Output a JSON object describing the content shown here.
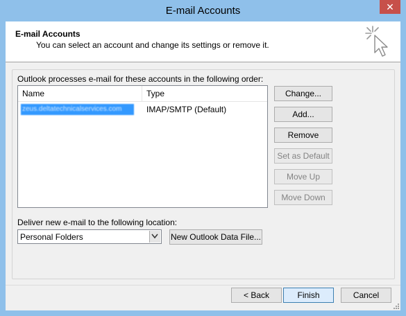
{
  "window": {
    "title": "E-mail Accounts",
    "close_label": "✕",
    "accent_color": "#8fc0ea",
    "close_color": "#c7504a"
  },
  "header": {
    "title": "E-mail Accounts",
    "subtitle": "You can select an account and change its settings or remove it.",
    "icon": "cursor-click-icon"
  },
  "accounts": {
    "caption": "Outlook processes e-mail for these accounts in the following order:",
    "columns": [
      "Name",
      "Type"
    ],
    "rows": [
      {
        "name": "zeus.deltatechnicalservices.com",
        "type": "IMAP/SMTP (Default)",
        "selected": true
      }
    ]
  },
  "side_buttons": {
    "change": "Change...",
    "add": "Add...",
    "remove": "Remove",
    "set_default": "Set as Default",
    "move_up": "Move Up",
    "move_down": "Move Down"
  },
  "delivery": {
    "caption": "Deliver new e-mail to the following location:",
    "selected": "Personal Folders",
    "new_file_button": "New Outlook Data File..."
  },
  "footer": {
    "back": "< Back",
    "finish": "Finish",
    "cancel": "Cancel"
  }
}
